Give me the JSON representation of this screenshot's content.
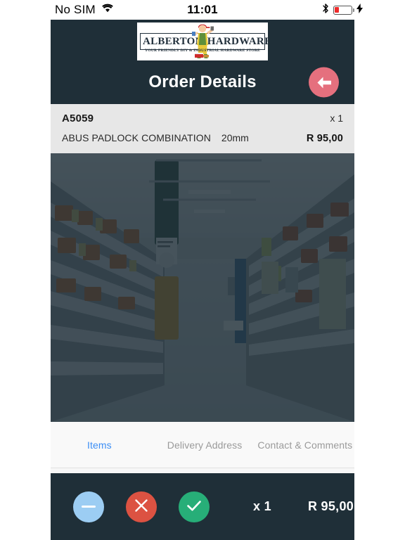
{
  "status_bar": {
    "carrier": "No SIM",
    "wifi_icon": "wifi-icon",
    "time": "11:01",
    "bluetooth_icon": "bluetooth-icon",
    "battery_percent": 25,
    "charging_icon": "lightning-bolt-icon"
  },
  "header": {
    "logo": {
      "word_left": "ALBERTON",
      "word_right": "HARDWARE",
      "tagline": "YOUR FRIENDLY DIY & INDUSTRIAL HARDWARE STORE",
      "mascot_icon": "handyman-mascot-icon"
    },
    "title": "Order Details",
    "back_button": {
      "icon": "arrow-left-icon",
      "color": "#e5707e"
    },
    "background_color": "#1f2f38"
  },
  "item": {
    "sku": "A5059",
    "quantity_label": "x 1",
    "description": "ABUS PADLOCK COMBINATION",
    "size": "20mm",
    "price": "R 95,00"
  },
  "hero": {
    "alt": "hardware-store-aisle-photo",
    "overlay_color": "#1b2c36"
  },
  "tabs": [
    {
      "label": "Items",
      "active": true
    },
    {
      "label": "Delivery Address",
      "active": false
    },
    {
      "label": "Contact & Comments",
      "active": false
    }
  ],
  "action_bar": {
    "minus_button": {
      "icon": "minus-icon",
      "color": "#9ccdf3"
    },
    "cancel_button": {
      "icon": "close-x-icon",
      "color": "#dc5242"
    },
    "confirm_button": {
      "icon": "check-icon",
      "color": "#27ae78"
    },
    "quantity": "x 1",
    "total": "R 95,00",
    "background_color": "#1f2f38"
  }
}
